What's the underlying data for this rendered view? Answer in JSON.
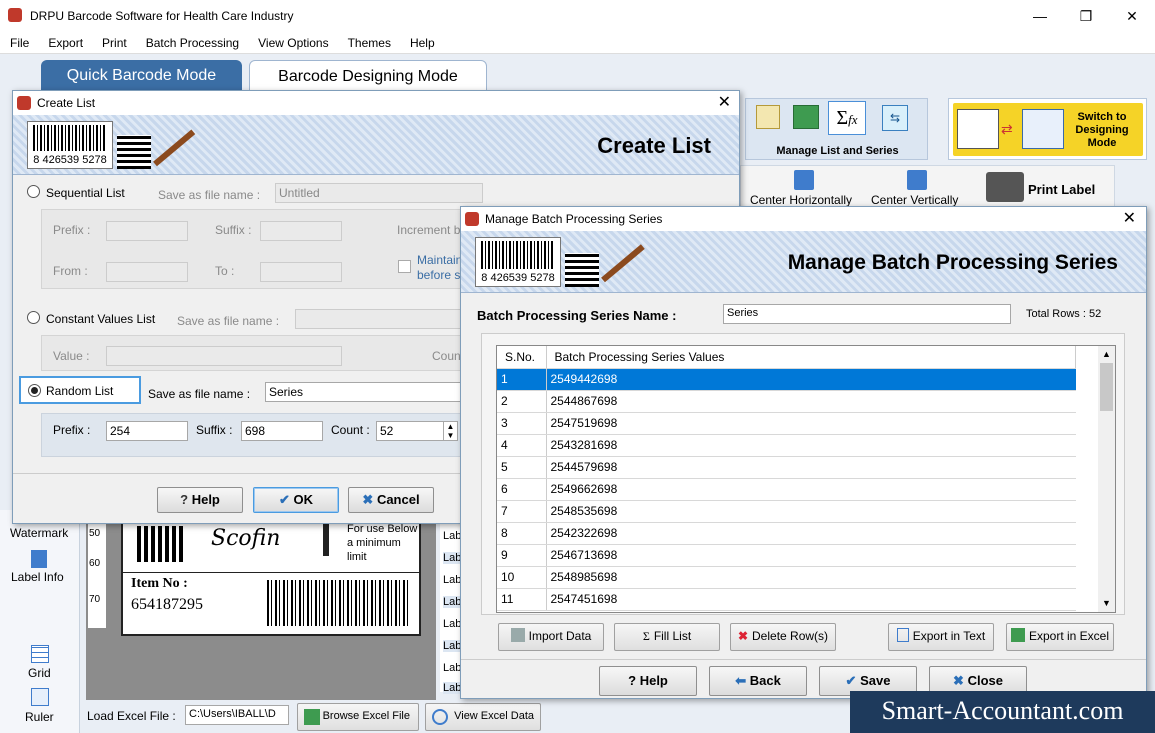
{
  "window": {
    "title": "DRPU Barcode Software for Health Care Industry"
  },
  "menu": [
    "File",
    "Export",
    "Print",
    "Batch Processing",
    "View Options",
    "Themes",
    "Help"
  ],
  "modes": {
    "quick": "Quick Barcode Mode",
    "designing": "Barcode Designing Mode"
  },
  "toolbar": {
    "manage_list": "Manage List and Series",
    "switch": "Switch to Designing Mode",
    "center_h": "Center Horizontally",
    "center_v": "Center Vertically",
    "print_label": "Print Label"
  },
  "left_panel": {
    "watermark": "Watermark",
    "label_info": "Label Info",
    "grid": "Grid",
    "ruler": "Ruler"
  },
  "ruler_marks": [
    "50",
    "60",
    "70"
  ],
  "label_preview": {
    "item_no_label": "Item No :",
    "item_no": "654187295",
    "note": "For use Below a minimum limit",
    "barcode_digits": "8 426539 5278"
  },
  "label_list": [
    "Lab",
    "Lab",
    "Lab",
    "Lab",
    "Lab",
    "Lab",
    "Lab",
    "Lab"
  ],
  "bottom": {
    "load_excel": "Load Excel File :",
    "path": "C:\\Users\\IBALL\\D",
    "browse": "Browse Excel File",
    "view": "View Excel Data"
  },
  "create_list": {
    "title": "Create List",
    "banner_title": "Create List",
    "sequential": "Sequential List",
    "save_as": "Save as file name :",
    "save_as_value": "Untitled",
    "prefix": "Prefix :",
    "suffix": "Suffix :",
    "increment": "Increment b",
    "from": "From :",
    "to": "To :",
    "maintain": "Maintain",
    "before": "before s",
    "constant": "Constant Values List",
    "value": "Value :",
    "count_label": "Coun",
    "random": "Random List",
    "random_save_value": "Series",
    "random_prefix": "254",
    "random_suffix": "698",
    "count": "Count :",
    "random_count": "52",
    "help": "Help",
    "ok": "OK",
    "cancel": "Cancel"
  },
  "batch": {
    "title": "Manage Batch Processing Series",
    "banner_title": "Manage Batch Processing Series",
    "name_label": "Batch Processing Series Name :",
    "name_value": "Series",
    "total_rows": "Total Rows : 52",
    "columns": [
      "S.No.",
      "Batch Processing Series Values"
    ],
    "rows": [
      [
        "1",
        "2549442698"
      ],
      [
        "2",
        "2544867698"
      ],
      [
        "3",
        "2547519698"
      ],
      [
        "4",
        "2543281698"
      ],
      [
        "5",
        "2544579698"
      ],
      [
        "6",
        "2549662698"
      ],
      [
        "7",
        "2548535698"
      ],
      [
        "8",
        "2542322698"
      ],
      [
        "9",
        "2546713698"
      ],
      [
        "10",
        "2548985698"
      ],
      [
        "11",
        "2547451698"
      ]
    ],
    "import": "Import Data",
    "fill": "Fill List",
    "delete": "Delete Row(s)",
    "export_text": "Export in Text",
    "export_excel": "Export in Excel",
    "help": "Help",
    "back": "Back",
    "save": "Save",
    "close": "Close"
  },
  "site_watermark": "Smart-Accountant.com",
  "colors": {
    "accent": "#0078d7",
    "banner": "#c7d7ec",
    "mode_tab": "#3b6ea5",
    "switch_bg": "#f5d327"
  }
}
